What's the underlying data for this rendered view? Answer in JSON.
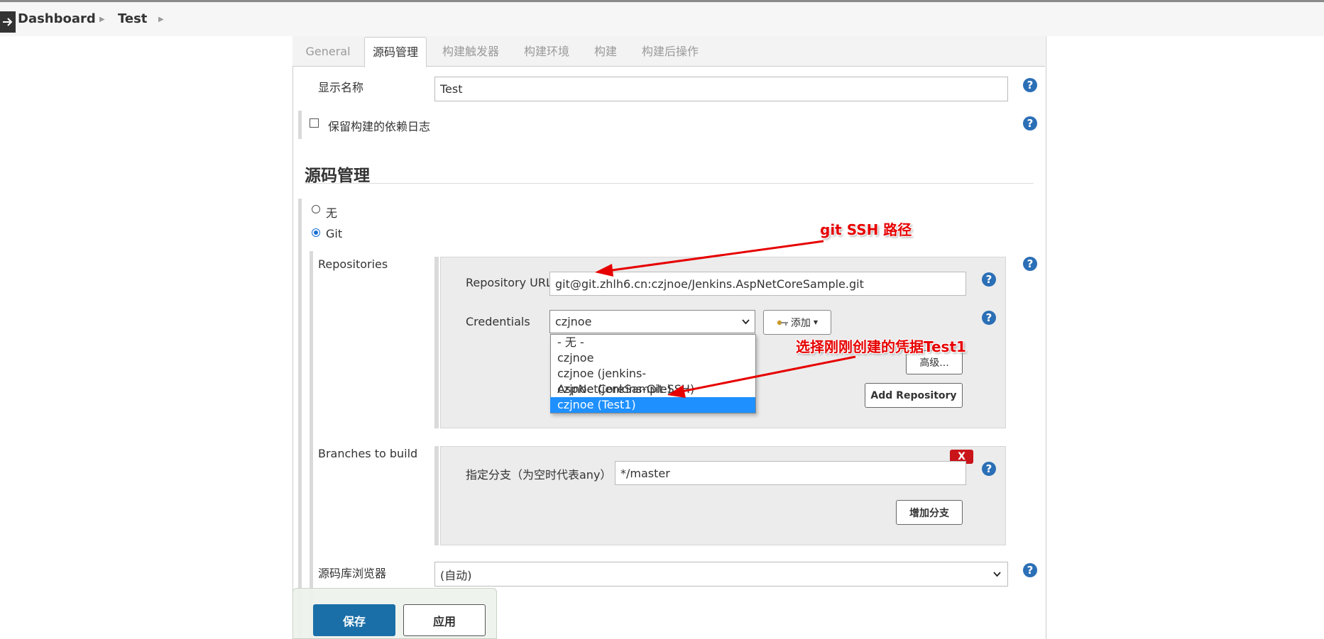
{
  "breadcrumb": {
    "dashboard": "Dashboard",
    "project": "Test"
  },
  "tabs": [
    "General",
    "源码管理",
    "构建触发器",
    "构建环境",
    "构建",
    "构建后操作"
  ],
  "general": {
    "display_name_label": "显示名称",
    "display_name_value": "Test",
    "keep_dependency_log_label": "保留构建的依赖日志"
  },
  "scm": {
    "section_title": "源码管理",
    "option_none": "无",
    "option_git": "Git",
    "repositories_label": "Repositories",
    "repo_url_label": "Repository URL",
    "repo_url_value": "git@git.zhlh6.cn:czjnoe/Jenkins.AspNetCoreSample.git",
    "credentials_label": "Credentials",
    "credentials_selected": "czjnoe",
    "add_button": "添加",
    "credentials_options": [
      "- 无 -",
      "czjnoe",
      "czjnoe (jenkins-AspNetCoreSample)",
      "czjnoe (jenkins-Git-SSH)",
      "czjnoe (Test1)"
    ],
    "advanced_button": "高级...",
    "add_repository_button": "Add Repository",
    "branches_label": "Branches to build",
    "branch_spec_label": "指定分支（为空时代表any）",
    "branch_spec_value": "*/master",
    "delete_branch_button": "X",
    "add_branch_button": "增加分支",
    "browser_label": "源码库浏览器",
    "browser_value": "(自动)"
  },
  "footer": {
    "save_button": "保存",
    "apply_button": "应用"
  },
  "annotations": {
    "ssh_path": "git SSH 路径",
    "select_credential": "选择刚刚创建的凭据Test1"
  },
  "colors": {
    "primary": "#1a6fa8",
    "help": "#2b6fb6",
    "annotation": "#e60000",
    "dropdown_selected": "#1e90ff"
  }
}
